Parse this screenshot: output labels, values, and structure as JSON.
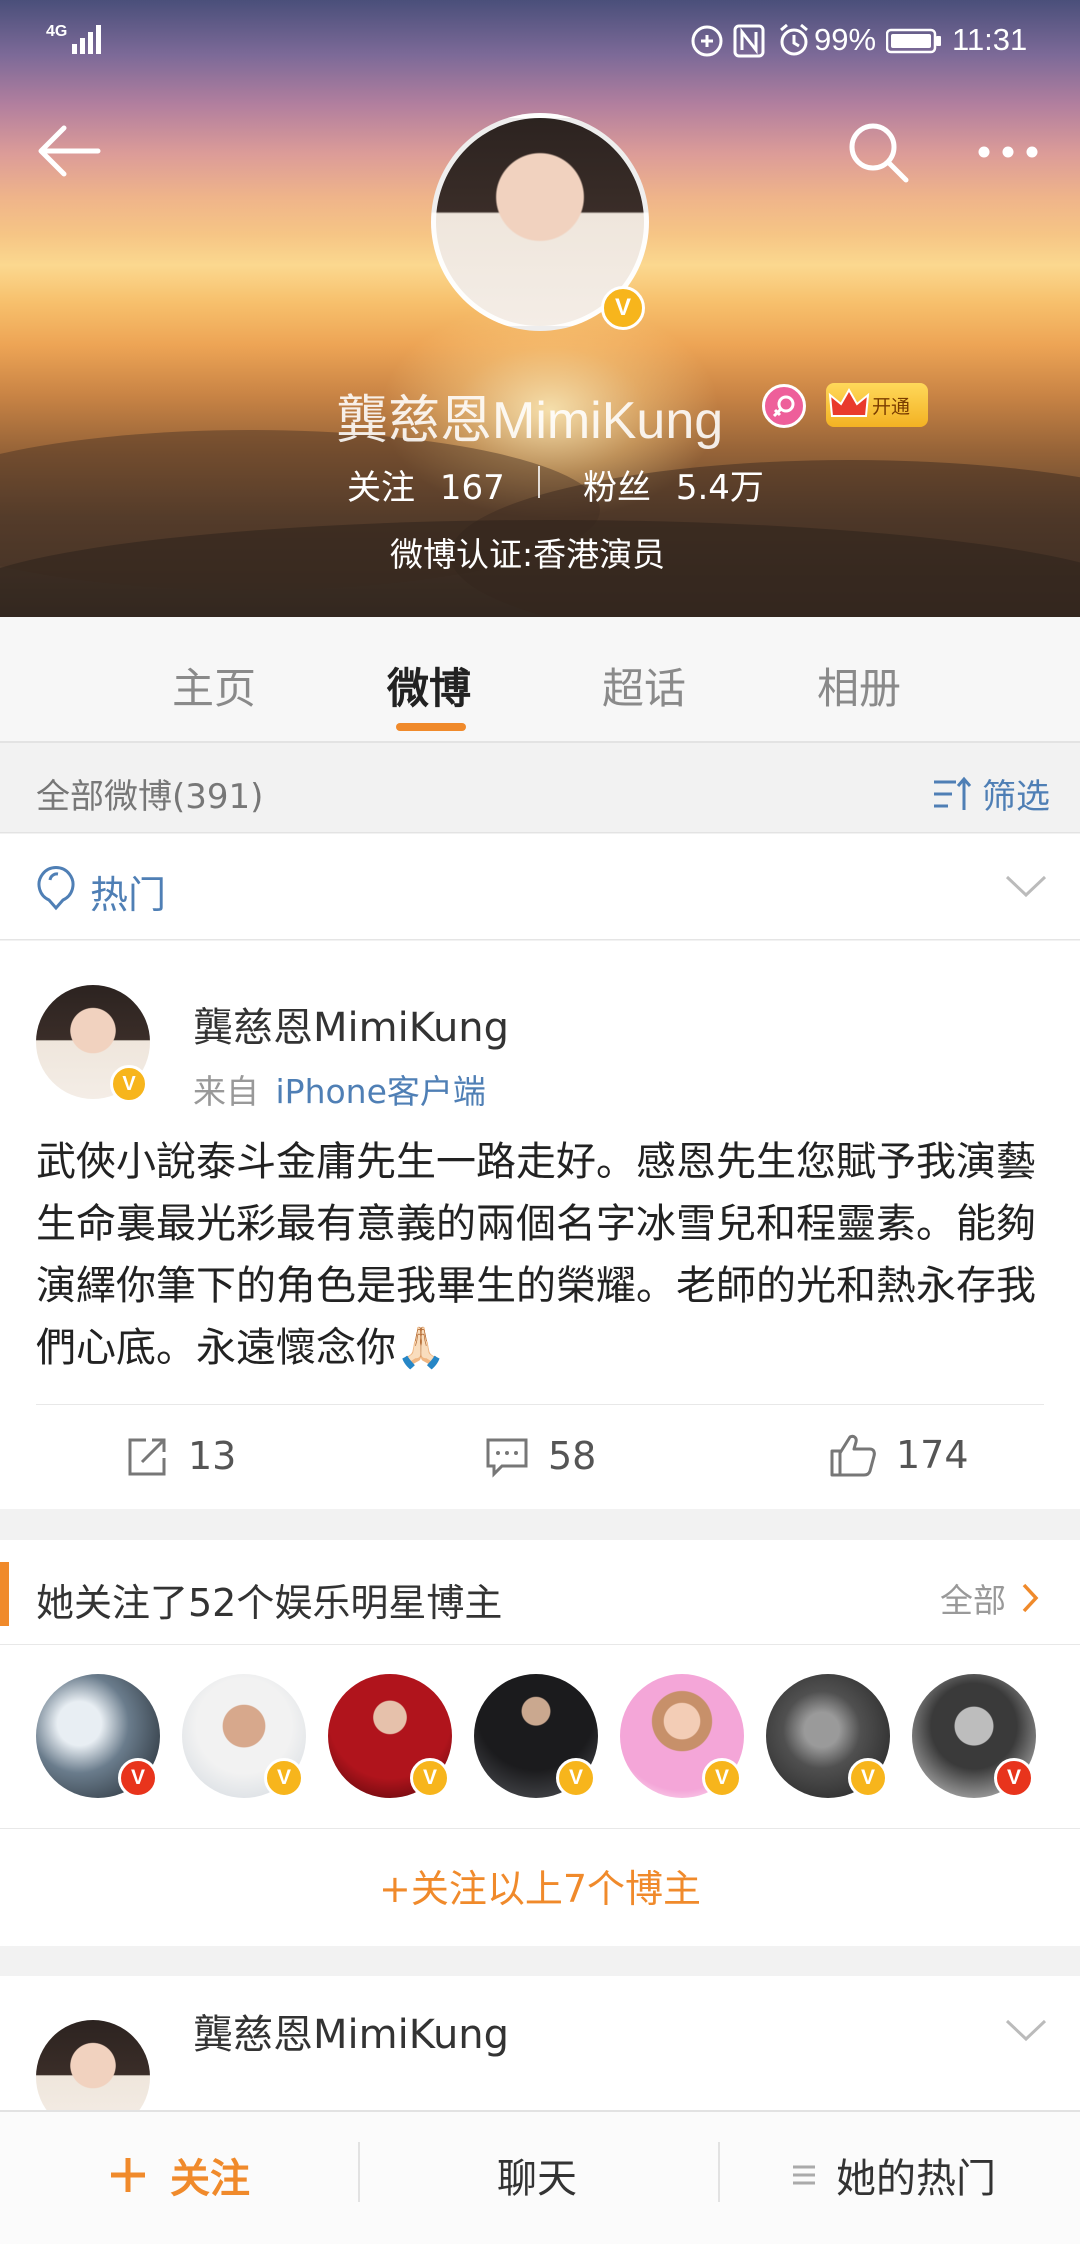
{
  "status_bar": {
    "signal": "4G",
    "battery": "99%",
    "time": "11:31"
  },
  "profile": {
    "name": "龔慈恩MimiKung",
    "vip_label": "开通",
    "following_label": "关注",
    "following_count": "167",
    "fans_label": "粉丝",
    "fans_count": "5.4万",
    "verification": "微博认证:香港演员",
    "avatar_badge": "V"
  },
  "tabs": [
    {
      "label": "主页"
    },
    {
      "label": "微博"
    },
    {
      "label": "超话"
    },
    {
      "label": "相册"
    }
  ],
  "filter_bar": {
    "all_label": "全部微博(391)",
    "filter_label": "筛选"
  },
  "hot": {
    "label": "热门"
  },
  "post": {
    "author": "龔慈恩MimiKung",
    "source_prefix": "来自",
    "source": "iPhone客户端",
    "text": "武俠小說泰斗金庸先生一路走好。感恩先生您賦予我演藝生命裏最光彩最有意義的兩個名字冰雪兒和程靈素。能夠演繹你筆下的角色是我畢生的榮耀。老師的光和熱永存我們心底。永遠懷念你🙏🏻",
    "reposts": "13",
    "comments": "58",
    "likes": "174"
  },
  "follows_card": {
    "title": "她关注了52个娱乐明星博主",
    "all_label": "全部",
    "follow_all": "+关注以上7个博主",
    "avatars": [
      {
        "badge": "V",
        "color": "#e8341c"
      },
      {
        "badge": "V",
        "color": "#f7b51c"
      },
      {
        "badge": "V",
        "color": "#f7b51c"
      },
      {
        "badge": "V",
        "color": "#f7b51c"
      },
      {
        "badge": "V",
        "color": "#f7b51c"
      },
      {
        "badge": "V",
        "color": "#f7b51c"
      },
      {
        "badge": "V",
        "color": "#e8341c"
      }
    ]
  },
  "post2": {
    "author": "龔慈恩MimiKung"
  },
  "bottom_bar": {
    "follow": "关注",
    "chat": "聊天",
    "hot": "她的热门"
  },
  "colors": {
    "accent": "#f08a2b",
    "link": "#4f7fb5"
  }
}
